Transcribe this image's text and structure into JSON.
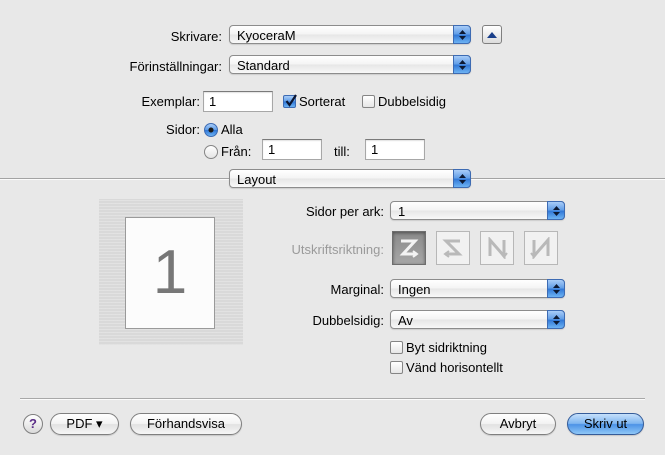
{
  "printer": {
    "label": "Skrivare:",
    "value": "KyoceraM"
  },
  "presets": {
    "label": "Förinställningar:",
    "value": "Standard"
  },
  "copies": {
    "label": "Exemplar:",
    "value": "1",
    "collated_label": "Sorterat",
    "collated": true,
    "duplex_label": "Dubbelsidig",
    "duplex": false
  },
  "pages": {
    "label": "Sidor:",
    "all_label": "Alla",
    "from_label": "Från:",
    "from_value": "1",
    "to_label": "till:",
    "to_value": "1",
    "selected": "all"
  },
  "section_menu": {
    "value": "Layout"
  },
  "preview": {
    "page_number": "1"
  },
  "layout": {
    "pages_per_sheet": {
      "label": "Sidor per ark:",
      "value": "1"
    },
    "orientation": {
      "label": "Utskriftsriktning:",
      "enabled": false,
      "options": [
        "z-order",
        "s-order",
        "n-order",
        "reverse-n-order"
      ],
      "selected_index": 0
    },
    "border": {
      "label": "Marginal:",
      "value": "Ingen"
    },
    "two_sided": {
      "label": "Dubbelsidig:",
      "value": "Av"
    },
    "reverse_orientation": {
      "label": "Byt sidriktning",
      "checked": false
    },
    "flip_horizontally": {
      "label": "Vänd horisontellt",
      "checked": false
    }
  },
  "footer": {
    "help": "?",
    "pdf_label": "PDF ▾",
    "preview_label": "Förhandsvisa",
    "cancel_label": "Avbryt",
    "print_label": "Skriv ut"
  },
  "colors": {
    "accent": "#3d8ae6",
    "default_button": "#6aa9ee",
    "disabled_text": "#9a9a9a"
  }
}
